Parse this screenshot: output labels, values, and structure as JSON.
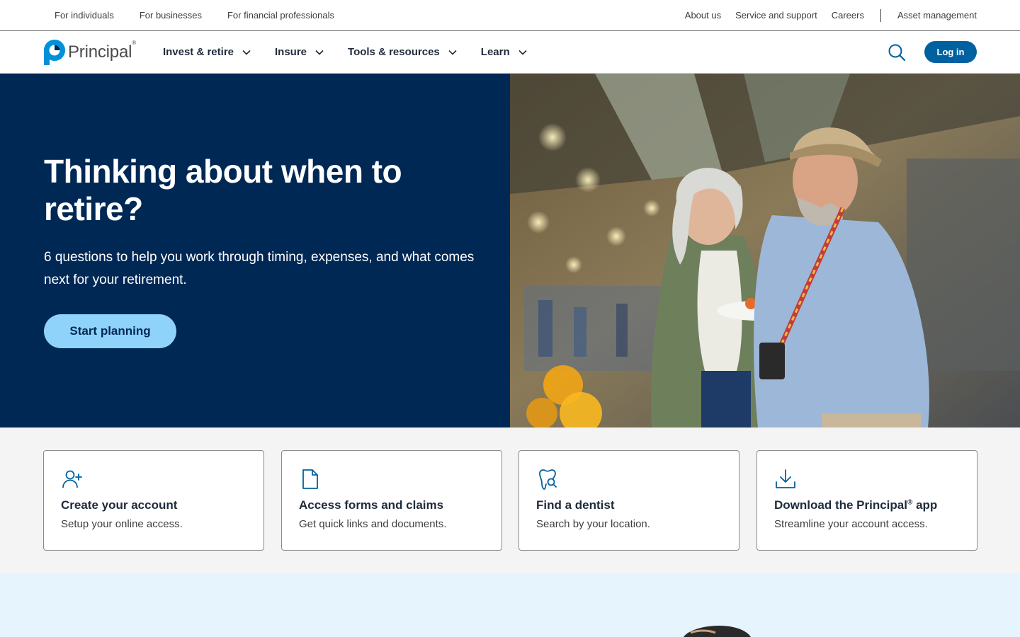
{
  "utility": {
    "left_links": [
      "For individuals",
      "For businesses",
      "For financial professionals"
    ],
    "right_links": [
      "About us",
      "Service and support",
      "Careers"
    ],
    "asset_link": "Asset management"
  },
  "nav": {
    "logo_text": "Principal",
    "logo_reg": "®",
    "items": [
      "Invest & retire",
      "Insure",
      "Tools & resources",
      "Learn"
    ],
    "login_label": "Log in"
  },
  "hero": {
    "title": "Thinking about when to retire?",
    "subtitle": "6 questions to help you work through timing, expenses, and what comes next for your retirement.",
    "cta_label": "Start planning"
  },
  "cards": [
    {
      "title": "Create your account",
      "desc": "Setup your online access.",
      "icon": "user-plus-icon"
    },
    {
      "title": "Access forms and claims",
      "desc": "Get quick links and documents.",
      "icon": "document-icon"
    },
    {
      "title": "Find a dentist",
      "desc": "Search by your location.",
      "icon": "tooth-search-icon"
    },
    {
      "title": "Download the Principal",
      "title_sup": "®",
      "title_suffix": " app",
      "desc": "Streamline your account access.",
      "icon": "download-icon"
    }
  ],
  "colors": {
    "navy": "#002855",
    "brand_blue": "#0061a0",
    "cta_light_blue": "#8fd3fb",
    "card_section_bg": "#f4f4f4",
    "bottom_band_bg": "#e6f5fd"
  }
}
